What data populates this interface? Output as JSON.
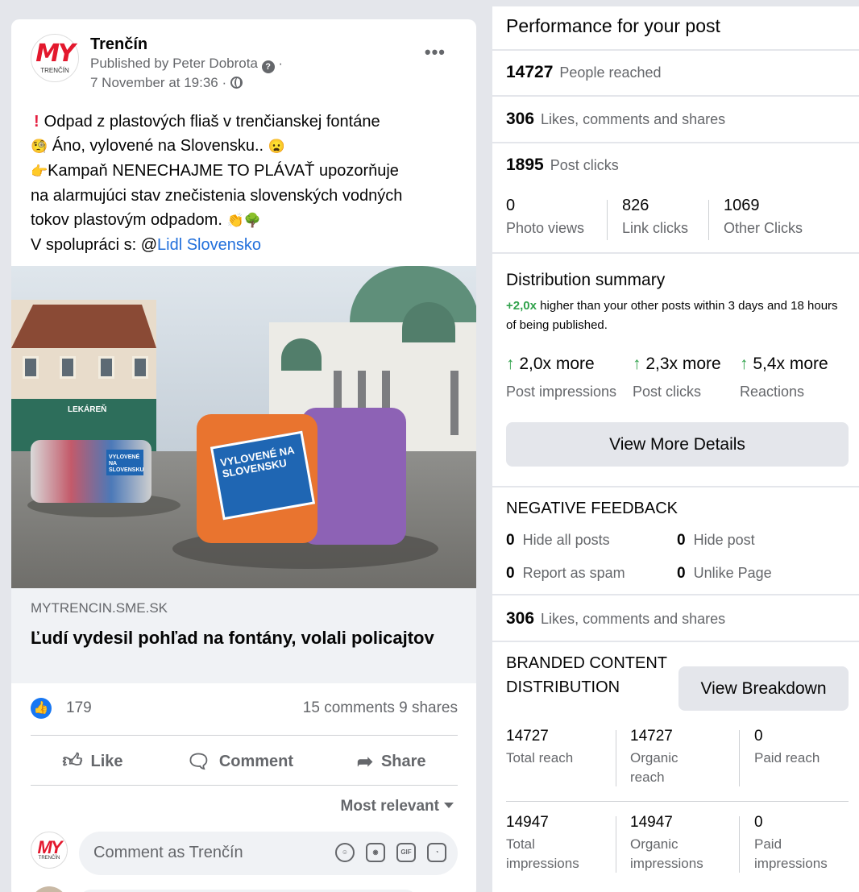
{
  "post": {
    "page_name": "Trenčín",
    "logo_text": "MY",
    "logo_sub": "TRENČÍN",
    "published_by": "Published by Peter Dobrota",
    "date": "7 November at 19:36 ·",
    "text_lines": [
      "Odpad z plastových fliaš v trenčianskej fontáne",
      "Áno, vylovené na Slovensku..",
      "Kampaň NENECHAJME TO PLÁVAŤ upozorňuje",
      "na alarmujúci stav znečistenia slovenských vodných",
      "tokov plastovým odpadom."
    ],
    "collab_prefix": "V spolupráci s: @",
    "collab_link": "Lidl Slovensko",
    "photo": {
      "sign_text": "VYLOVENÉ NA SLOVENSKU",
      "sign_small": "VYLOVENÉ NA SLOVENSKU",
      "shop_sign": "LEKÁREŇ"
    },
    "link_domain": "MYTRENCIN.SME.SK",
    "link_title": "Ľudí vydesil pohľad na fontány, volali policajtov",
    "like_count": "179",
    "comments": "15 comments",
    "shares": "9 shares",
    "actions": {
      "like": "Like",
      "comment": "Comment",
      "share": "Share"
    },
    "sort_label": "Most relevant",
    "comment_placeholder": "Comment as Trenčín",
    "gif_label": "GIF"
  },
  "panel": {
    "title": "Performance for your post",
    "people_reached": {
      "value": "14727",
      "label": "People reached"
    },
    "engagement": {
      "value": "306",
      "label": "Likes, comments and shares"
    },
    "post_clicks": {
      "value": "1895",
      "label": "Post clicks"
    },
    "clicks_breakdown": [
      {
        "value": "0",
        "label": "Photo views"
      },
      {
        "value": "826",
        "label": "Link clicks"
      },
      {
        "value": "1069",
        "label": "Other Clicks"
      }
    ],
    "distribution": {
      "title": "Distribution summary",
      "highlight": "+2,0x",
      "desc": "higher than your other posts within 3 days and 18 hours of being published.",
      "multipliers": [
        {
          "value": "2,0x more",
          "label": "Post impressions"
        },
        {
          "value": "2,3x more",
          "label": "Post clicks"
        },
        {
          "value": "5,4x more",
          "label": "Reactions"
        }
      ],
      "button": "View More Details"
    },
    "negative": {
      "title": "NEGATIVE FEEDBACK",
      "items": [
        {
          "value": "0",
          "label": "Hide all posts"
        },
        {
          "value": "0",
          "label": "Hide post"
        },
        {
          "value": "0",
          "label": "Report as spam"
        },
        {
          "value": "0",
          "label": "Unlike Page"
        }
      ]
    },
    "engagement2": {
      "value": "306",
      "label": "Likes, comments and shares"
    },
    "branded": {
      "title": "BRANDED CONTENT DISTRIBUTION",
      "button": "View Breakdown",
      "reach": [
        {
          "value": "14727",
          "label": "Total reach"
        },
        {
          "value": "14727",
          "label": "Organic reach"
        },
        {
          "value": "0",
          "label": "Paid reach"
        }
      ],
      "impressions": [
        {
          "value": "14947",
          "label": "Total impressions"
        },
        {
          "value": "14947",
          "label": "Organic impressions"
        },
        {
          "value": "0",
          "label": "Paid impressions"
        }
      ]
    },
    "colors": {
      "accent": "#1877f2",
      "green": "#31a24c",
      "link": "#216fdb"
    }
  }
}
